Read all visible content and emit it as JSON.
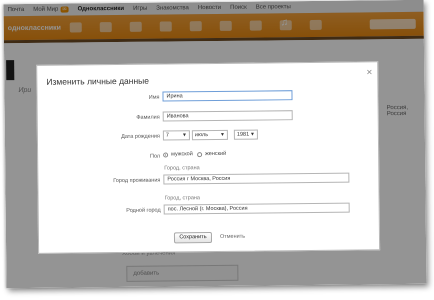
{
  "topnav": {
    "items": [
      "Почта",
      "Мой Мир",
      "Одноклассники",
      "Игры",
      "Знакомства",
      "Новости",
      "Поиск",
      "Все проекты"
    ],
    "mail_count": "✉",
    "active_item": "Одноклассники"
  },
  "header": {
    "logo_text": "одноклассники",
    "icons": [
      "friends-icon",
      "photos-icon",
      "groups-icon",
      "events-icon",
      "games-icon",
      "guests-icon",
      "gifts-icon",
      "music-icon",
      "video-icon"
    ]
  },
  "background": {
    "profile_name": "Ири",
    "right_snippet": "Россия, Россия",
    "below_label": "Хобби и увлечения",
    "below_box_text": "добавить"
  },
  "modal": {
    "title": "Изменить личные данные",
    "close_label": "×",
    "first_name": {
      "label": "Имя",
      "value": "Ирина"
    },
    "last_name": {
      "label": "Фамилия",
      "value": "Иванова"
    },
    "birthdate": {
      "label": "Дата рождения",
      "day": "7",
      "month": "июль",
      "year": "1981"
    },
    "gender": {
      "label": "Пол",
      "male": "мужской",
      "female": "женский",
      "selected": "мужской"
    },
    "residence": {
      "hint": "Город, страна",
      "label": "Город проживания",
      "value": "Россия г Москва, Россия"
    },
    "hometown": {
      "hint": "Город, страна",
      "label": "Родной город",
      "value": "пос. Лесной (г. Москва), Россия"
    },
    "save_label": "Сохранить",
    "cancel_label": "Отменить"
  },
  "colors": {
    "brand_orange": "#ef9420",
    "overlay": "rgba(0,0,0,0.42)"
  }
}
